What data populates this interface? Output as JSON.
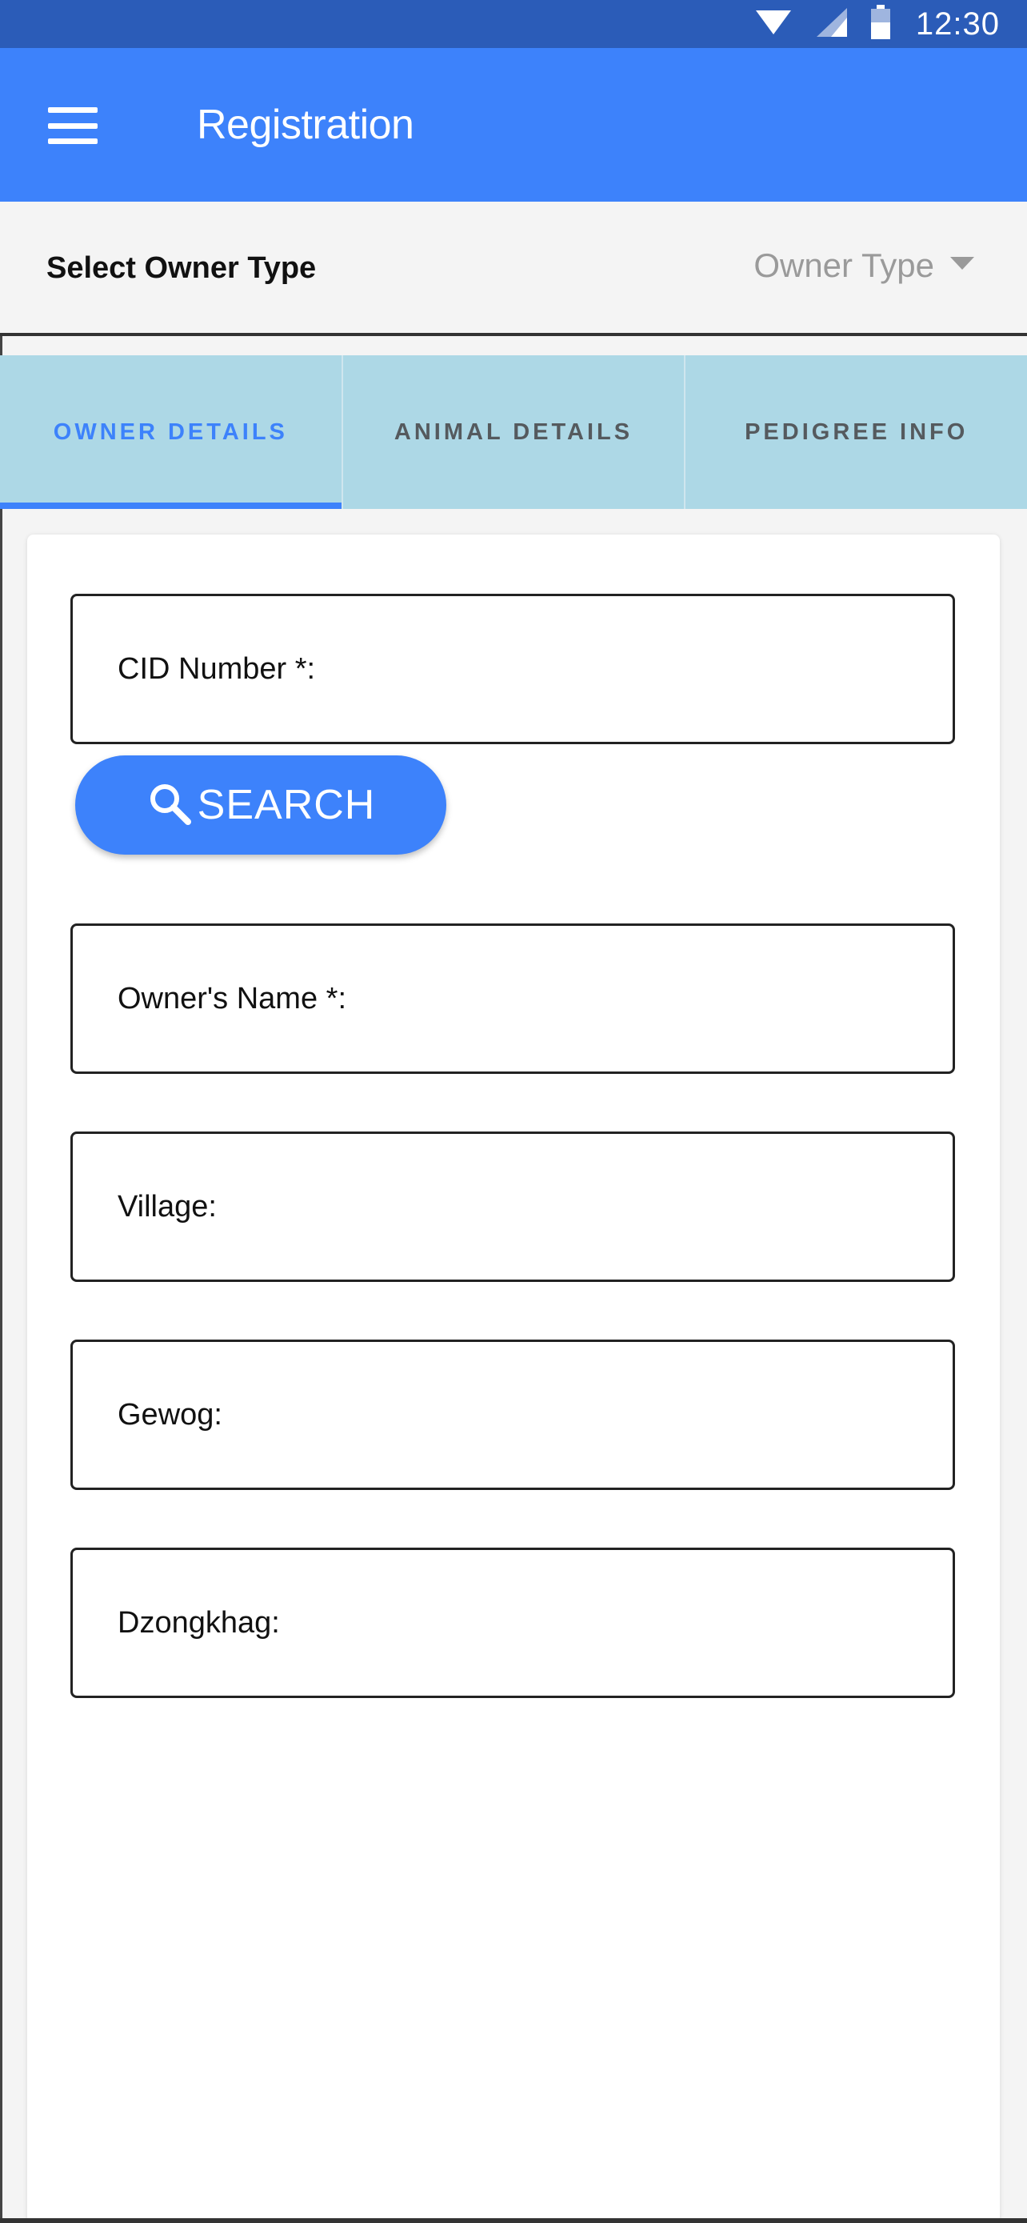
{
  "status_bar": {
    "time": "12:30",
    "icons": [
      "wifi-icon",
      "cell-signal-icon",
      "battery-icon"
    ]
  },
  "app_bar": {
    "title": "Registration",
    "menu_icon": "hamburger-menu-icon"
  },
  "owner_type": {
    "label": "Select Owner Type",
    "placeholder": "Owner Type"
  },
  "tabs": [
    {
      "label": "OWNER DETAILS",
      "active": true
    },
    {
      "label": "ANIMAL DETAILS",
      "active": false
    },
    {
      "label": "PEDIGREE INFO",
      "active": false
    }
  ],
  "form": {
    "cid_label": "CID Number *:",
    "search_label": "SEARCH",
    "search_icon": "search-icon",
    "owner_name_label": "Owner's Name *:",
    "village_label": "Village:",
    "gewog_label": "Gewog:",
    "dzongkhag_label": "Dzongkhag:"
  },
  "colors": {
    "primary": "#3d82fb",
    "status_bar": "#2b5cb8",
    "tab_background": "#add8e6",
    "placeholder": "#9a9a9a"
  }
}
